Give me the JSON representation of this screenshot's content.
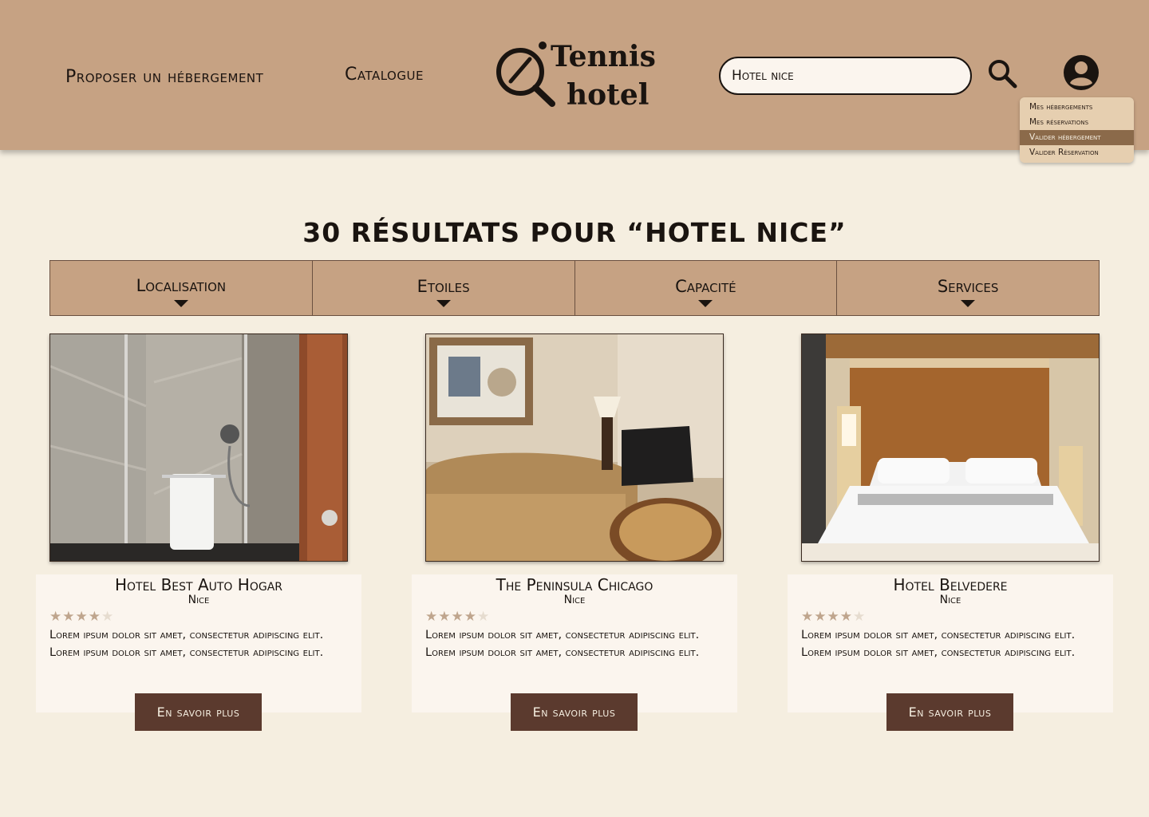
{
  "header": {
    "nav_propose": "Proposer un hébergement",
    "nav_catalogue": "Catalogue",
    "logo_line1": "Tennis",
    "logo_line2": "hotel",
    "search_value": "Hotel nice",
    "icons": {
      "search": "search-icon",
      "account": "account-circle-icon"
    }
  },
  "account_menu": {
    "items": [
      {
        "label": "Mes hébergements",
        "active": false
      },
      {
        "label": "Mes réservations",
        "active": false
      },
      {
        "label": "Valider hébergement",
        "active": true
      },
      {
        "label": "Valider Réservation",
        "active": false
      }
    ]
  },
  "results": {
    "title": "30 RÉSULTATS POUR “HOTEL NICE”"
  },
  "filters": [
    {
      "label": "Localisation"
    },
    {
      "label": "Etoiles"
    },
    {
      "label": "Capacité"
    },
    {
      "label": "Services"
    }
  ],
  "cards": [
    {
      "name": "Hotel Best Auto Hogar",
      "city": "Nice",
      "rating": 4,
      "max_rating": 5,
      "description": "Lorem ipsum dolor sit amet, consectetur adipiscing elit.  Lorem ipsum dolor sit amet, consectetur adipiscing elit.",
      "button": "En savoir plus",
      "photo": "bathroom-shower-photo"
    },
    {
      "name": "The Peninsula Chicago",
      "city": "Nice",
      "rating": 4,
      "max_rating": 5,
      "description": "Lorem ipsum dolor sit amet, consectetur adipiscing elit.  Lorem ipsum dolor sit amet, consectetur adipiscing elit.",
      "button": "En savoir plus",
      "photo": "living-room-sofa-photo"
    },
    {
      "name": "Hotel Belvedere",
      "city": "Nice",
      "rating": 4,
      "max_rating": 5,
      "description": "Lorem ipsum dolor sit amet, consectetur adipiscing elit.  Lorem ipsum dolor sit amet, consectetur adipiscing elit.",
      "button": "En savoir plus",
      "photo": "bedroom-bed-photo"
    }
  ],
  "colors": {
    "header_bg": "#c6a283",
    "page_bg": "#f5eee0",
    "card_bg": "#fbf5ee",
    "button_bg": "#5b3a2e",
    "menu_active": "#8b6a4a"
  }
}
